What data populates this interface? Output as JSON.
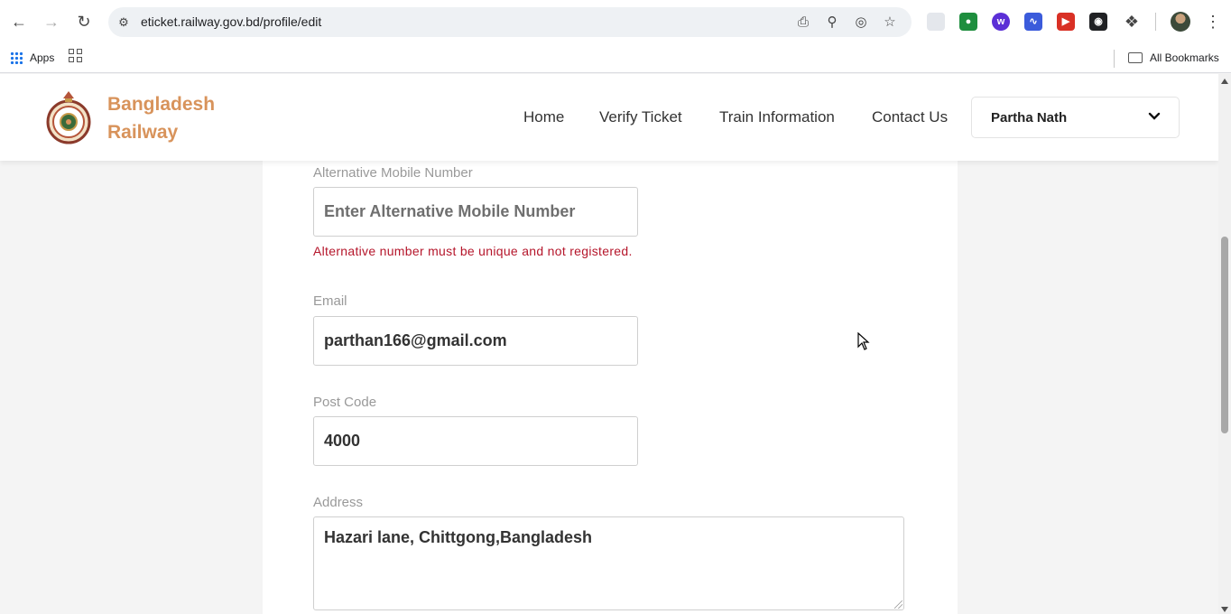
{
  "browser": {
    "url": "eticket.railway.gov.bd/profile/edit",
    "bookmarks": {
      "apps_label": "Apps",
      "all_bookmarks_label": "All Bookmarks"
    },
    "icons": [
      "back-icon",
      "forward-icon",
      "reload-icon",
      "site-settings-icon",
      "install-icon",
      "zoom-icon",
      "eye-off-icon",
      "star-icon",
      "puzzle-icon",
      "menu-icon"
    ]
  },
  "site": {
    "brand_line1": "Bangladesh",
    "brand_line2": "Railway",
    "brand_color": "#d8935b",
    "nav": [
      "Home",
      "Verify Ticket",
      "Train Information",
      "Contact Us"
    ],
    "user_name": "Partha Nath"
  },
  "form": {
    "alt_mobile": {
      "label": "Alternative Mobile Number",
      "placeholder": "Enter Alternative Mobile Number",
      "error": "Alternative number must be unique and not registered."
    },
    "email": {
      "label": "Email",
      "value": "parthan166@gmail.com"
    },
    "post_code": {
      "label": "Post Code",
      "value": "4000"
    },
    "address": {
      "label": "Address",
      "value": "Hazari lane, Chittgong,Bangladesh"
    }
  },
  "colors": {
    "error": "#b5162b",
    "label": "#999999"
  }
}
